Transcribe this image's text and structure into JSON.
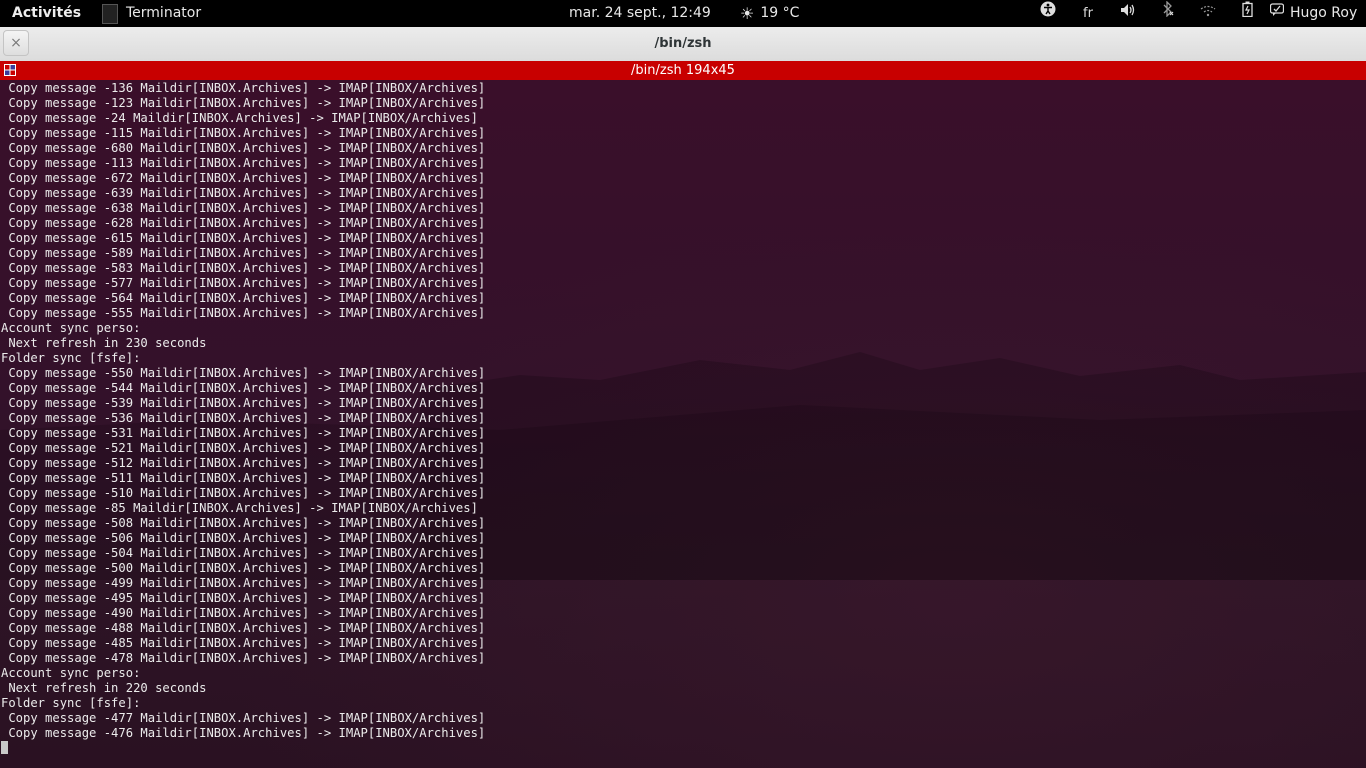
{
  "topbar": {
    "activities": "Activités",
    "app_name": "Terminator",
    "clock": "mar. 24 sept., 12:49",
    "weather": "19 °C",
    "keyboard_layout": "fr",
    "user_name": "Hugo Roy",
    "icons": [
      "accessibility-icon",
      "volume-icon",
      "bluetooth-icon",
      "network-icon",
      "battery-icon",
      "user-icon"
    ]
  },
  "window": {
    "title": "/bin/zsh",
    "close_symbol": "×"
  },
  "terminal": {
    "title": "/bin/zsh 194x45",
    "lines": [
      " Copy message -136 Maildir[INBOX.Archives] -> IMAP[INBOX/Archives]",
      " Copy message -123 Maildir[INBOX.Archives] -> IMAP[INBOX/Archives]",
      " Copy message -24 Maildir[INBOX.Archives] -> IMAP[INBOX/Archives]",
      " Copy message -115 Maildir[INBOX.Archives] -> IMAP[INBOX/Archives]",
      " Copy message -680 Maildir[INBOX.Archives] -> IMAP[INBOX/Archives]",
      " Copy message -113 Maildir[INBOX.Archives] -> IMAP[INBOX/Archives]",
      " Copy message -672 Maildir[INBOX.Archives] -> IMAP[INBOX/Archives]",
      " Copy message -639 Maildir[INBOX.Archives] -> IMAP[INBOX/Archives]",
      " Copy message -638 Maildir[INBOX.Archives] -> IMAP[INBOX/Archives]",
      " Copy message -628 Maildir[INBOX.Archives] -> IMAP[INBOX/Archives]",
      " Copy message -615 Maildir[INBOX.Archives] -> IMAP[INBOX/Archives]",
      " Copy message -589 Maildir[INBOX.Archives] -> IMAP[INBOX/Archives]",
      " Copy message -583 Maildir[INBOX.Archives] -> IMAP[INBOX/Archives]",
      " Copy message -577 Maildir[INBOX.Archives] -> IMAP[INBOX/Archives]",
      " Copy message -564 Maildir[INBOX.Archives] -> IMAP[INBOX/Archives]",
      " Copy message -555 Maildir[INBOX.Archives] -> IMAP[INBOX/Archives]",
      "Account sync perso:",
      " Next refresh in 230 seconds",
      "Folder sync [fsfe]:",
      " Copy message -550 Maildir[INBOX.Archives] -> IMAP[INBOX/Archives]",
      " Copy message -544 Maildir[INBOX.Archives] -> IMAP[INBOX/Archives]",
      " Copy message -539 Maildir[INBOX.Archives] -> IMAP[INBOX/Archives]",
      " Copy message -536 Maildir[INBOX.Archives] -> IMAP[INBOX/Archives]",
      " Copy message -531 Maildir[INBOX.Archives] -> IMAP[INBOX/Archives]",
      " Copy message -521 Maildir[INBOX.Archives] -> IMAP[INBOX/Archives]",
      " Copy message -512 Maildir[INBOX.Archives] -> IMAP[INBOX/Archives]",
      " Copy message -511 Maildir[INBOX.Archives] -> IMAP[INBOX/Archives]",
      " Copy message -510 Maildir[INBOX.Archives] -> IMAP[INBOX/Archives]",
      " Copy message -85 Maildir[INBOX.Archives] -> IMAP[INBOX/Archives]",
      " Copy message -508 Maildir[INBOX.Archives] -> IMAP[INBOX/Archives]",
      " Copy message -506 Maildir[INBOX.Archives] -> IMAP[INBOX/Archives]",
      " Copy message -504 Maildir[INBOX.Archives] -> IMAP[INBOX/Archives]",
      " Copy message -500 Maildir[INBOX.Archives] -> IMAP[INBOX/Archives]",
      " Copy message -499 Maildir[INBOX.Archives] -> IMAP[INBOX/Archives]",
      " Copy message -495 Maildir[INBOX.Archives] -> IMAP[INBOX/Archives]",
      " Copy message -490 Maildir[INBOX.Archives] -> IMAP[INBOX/Archives]",
      " Copy message -488 Maildir[INBOX.Archives] -> IMAP[INBOX/Archives]",
      " Copy message -485 Maildir[INBOX.Archives] -> IMAP[INBOX/Archives]",
      " Copy message -478 Maildir[INBOX.Archives] -> IMAP[INBOX/Archives]",
      "Account sync perso:",
      " Next refresh in 220 seconds",
      "Folder sync [fsfe]:",
      " Copy message -477 Maildir[INBOX.Archives] -> IMAP[INBOX/Archives]",
      " Copy message -476 Maildir[INBOX.Archives] -> IMAP[INBOX/Archives]"
    ]
  },
  "colors": {
    "terminal_titlebar": "#c80000",
    "terminal_background": "#33112a",
    "terminal_text": "#ececec",
    "topbar_background": "#000000"
  }
}
